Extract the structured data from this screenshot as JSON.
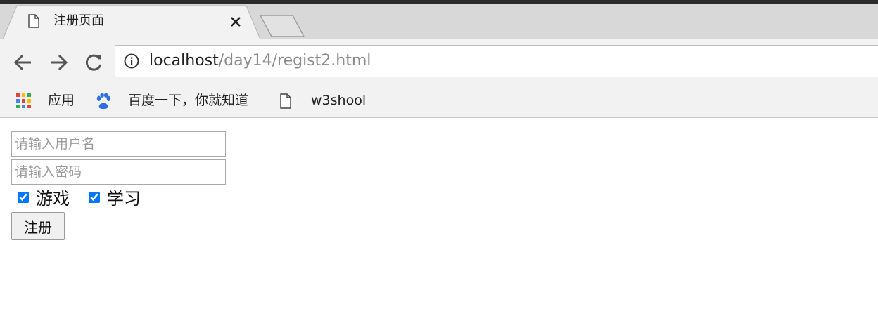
{
  "tab": {
    "title": "注册页面",
    "favicon": "page-icon",
    "close_icon": "close-icon"
  },
  "nav": {
    "back_icon": "arrow-left-icon",
    "forward_icon": "arrow-right-icon",
    "reload_icon": "reload-icon"
  },
  "address": {
    "info_icon": "info-icon",
    "host": "localhost",
    "path": "/day14/regist2.html"
  },
  "bookmarks": [
    {
      "label": "应用",
      "icon": "apps-grid-icon"
    },
    {
      "label": "百度一下，你就知道",
      "icon": "baidu-paw-icon"
    },
    {
      "label": "w3shool",
      "icon": "page-icon"
    }
  ],
  "form": {
    "username_placeholder": "请输入用户名",
    "password_placeholder": "请输入密码",
    "checkboxes": [
      {
        "label": "游戏",
        "checked": true
      },
      {
        "label": "学习",
        "checked": true
      }
    ],
    "submit_label": "注册"
  },
  "colors": {
    "frame": "#2b2b2b",
    "tabstrip": "#d8d8d8",
    "toolbar": "#f2f2f2"
  }
}
